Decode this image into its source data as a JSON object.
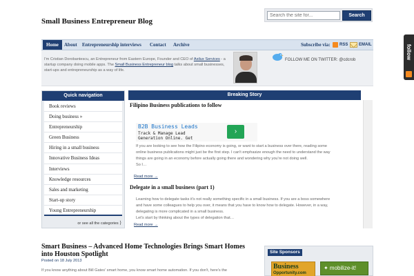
{
  "site": {
    "title": "Small Business Entrepreneur Blog"
  },
  "search": {
    "placeholder": "Search the site for...",
    "button": "Search"
  },
  "nav": {
    "items": [
      "Home",
      "About",
      "Entrepreneurship interviews",
      "Contact",
      "Archive"
    ],
    "subscribe_label": "Subscribe via:",
    "rss_label": "RSS",
    "email_label": "EMAIL"
  },
  "about": {
    "text_before": "I'm Cristian Dorobantescu, an Entrepreneur from Eastern Europe, Founder and CEO of ",
    "link1": "Axilux Services",
    "text_middle": " - a startup company doing mobile apps. The ",
    "link2": "Small Business Entrepreneur blog",
    "text_after": " talks about small businesses, start-ups and entrepreneurship as a way of life.",
    "twitter_text": "FOLLOW ME ON TWITTER: @cdcrob"
  },
  "side_tab": {
    "label": "follow"
  },
  "quick_nav": {
    "header": "Quick navigation",
    "items": [
      "Book reviews",
      "Doing business »",
      "Entrepreneurship",
      "Green Business",
      "Hiring in a small business",
      "Innovative Business Ideas",
      "Interviews",
      "Knowledge resources",
      "Sales and marketing",
      "Start-up story",
      "Young Entrepreneurship"
    ],
    "see_all": "or see all the categories"
  },
  "breaking": {
    "header": "Breaking Story",
    "ad": {
      "title": "B2B Business Leads",
      "line1": "Track & Manage Lead",
      "line2": "Generation Online. Get",
      "button": "›"
    },
    "stories": [
      {
        "title": "Filipino Business publications to follow",
        "body1": "If you are looking to see how the Filipino economy is going, or want to start a business over there, reading some",
        "body2": "online business publications might just be the first step. I can't emphasize enough the need to understand the way",
        "body3": "things are going in an economy before actually going there and wondering why you're not doing well.",
        "body4": "So I…",
        "read_more": "Read more →"
      },
      {
        "title": "Delegate in a small business (part 1)",
        "body1": "Learning how to delegate tasks it's not really something specific in a small business. If you are a boss somewhere",
        "body2": "and have some colleagues to help you over, it means that you have to know how to delegate. However, in a way,",
        "body3": "delegating is more complicated in a small business.",
        "body4": "Let's start by thinking about the types of delegation that…",
        "read_more": "Read more →"
      }
    ]
  },
  "post": {
    "title": "Smart Business – Advanced Home Technologies Brings Smart Homes into Houston Spotlight",
    "meta": "Posted on 18 July 2013",
    "excerpt": "If you know anything about Bill Gates' smart home, you know smart home automation. If you don't, here's the"
  },
  "sponsors": {
    "header": "Site Sponsors",
    "sponsor1_line1": "Business",
    "sponsor1_line2": "Opportunity.com",
    "sponsor2": "✦ mobilize-it!"
  },
  "colors": {
    "brand": "#1f3f73",
    "nav_bg": "#d9e3ef",
    "rss": "#f58a1f"
  }
}
